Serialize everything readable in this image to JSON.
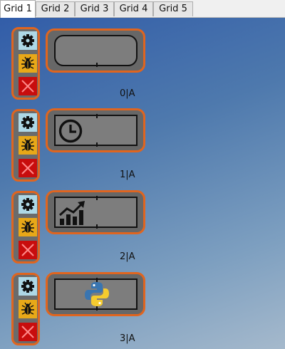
{
  "tabs": [
    {
      "label": "Grid 1",
      "active": true
    },
    {
      "label": "Grid 2",
      "active": false
    },
    {
      "label": "Grid 3",
      "active": false
    },
    {
      "label": "Grid 4",
      "active": false
    },
    {
      "label": "Grid 5",
      "active": false
    }
  ],
  "colors": {
    "frame": "#e0651f",
    "gear_button": "#aed8e6",
    "bug_button": "#e8a818",
    "close_button": "#c80d0d"
  },
  "cells": [
    {
      "label": "0|A",
      "icon": "none"
    },
    {
      "label": "1|A",
      "icon": "clock-icon"
    },
    {
      "label": "2|A",
      "icon": "chart-trend-icon"
    },
    {
      "label": "3|A",
      "icon": "python-logo-icon"
    }
  ]
}
